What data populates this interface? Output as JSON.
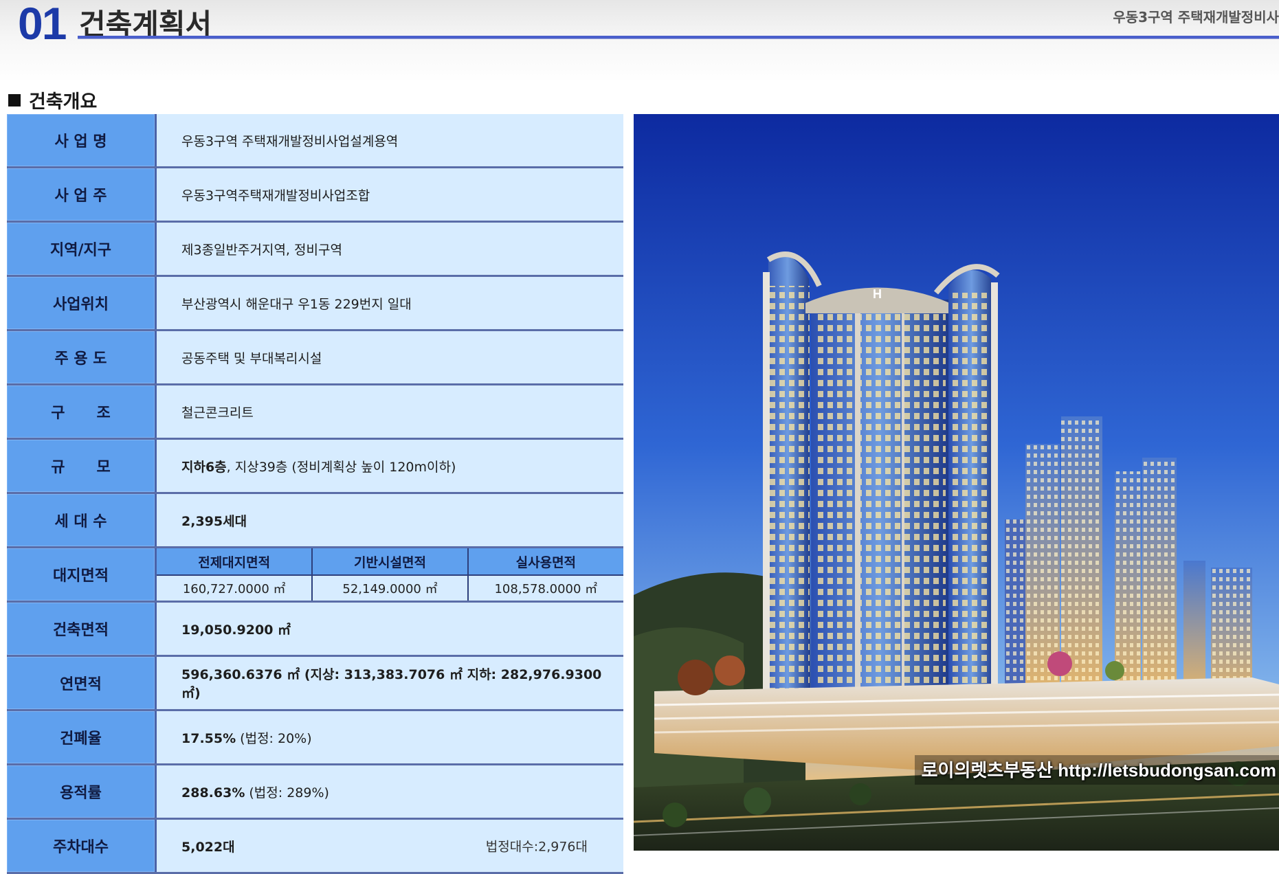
{
  "header": {
    "page_number": "01",
    "title": "건축계획서",
    "right_text": "우동3구역 주택재개발정비사"
  },
  "section_heading": "건축개요",
  "rows": [
    {
      "label": "사 업 명",
      "value": "우동3구역 주택재개발정비사업설계용역"
    },
    {
      "label": "사 업 주",
      "value": "우동3구역주택재개발정비사업조합"
    },
    {
      "label": "지역/지구",
      "value": "제3종일반주거지역, 정비구역"
    },
    {
      "label": "사업위치",
      "value": "부산광역시 해운대구 우1동 229번지 일대"
    },
    {
      "label": "주 용 도",
      "value": "공동주택 및 부대복리시설"
    },
    {
      "label": "구      조",
      "value": "철근콘크리트"
    },
    {
      "label": "규      모",
      "value_bold": "지하6층",
      "value_rest": ", 지상39층 (정비계획상 높이 120m이하)"
    },
    {
      "label": "세 대 수",
      "value_bold": "2,395세대"
    }
  ],
  "site_area": {
    "label": "대지면적",
    "headers": [
      "전제대지면적",
      "기반시설면적",
      "실사용면적"
    ],
    "values": [
      "160,727.0000 ㎡",
      "52,149.0000 ㎡",
      "108,578.0000 ㎡"
    ]
  },
  "rows2": [
    {
      "label": "건축면적",
      "value_bold": "19,050.9200 ㎡"
    },
    {
      "label": "연면적",
      "value_bold": "596,360.6376 ㎡ (지상: 313,383.7076 ㎡ 지하: 282,976.9300 ㎡)"
    },
    {
      "label": "건폐율",
      "value_bold": "17.55%",
      "value_rest": " (법정: 20%)"
    },
    {
      "label": "용적률",
      "value_bold": "288.63%",
      "value_rest": " (법정: 289%)"
    },
    {
      "label": "주차대수",
      "value_bold": "5,022대",
      "note": "법정대수:2,976대"
    }
  ],
  "photo": {
    "watermark": "로이의렛츠부동산 http://letsbudongsan.com",
    "sign": "H"
  },
  "colors": {
    "label_bg": "#5fa0ee",
    "value_bg": "#d7ecff",
    "accent": "#1c3aa8"
  }
}
